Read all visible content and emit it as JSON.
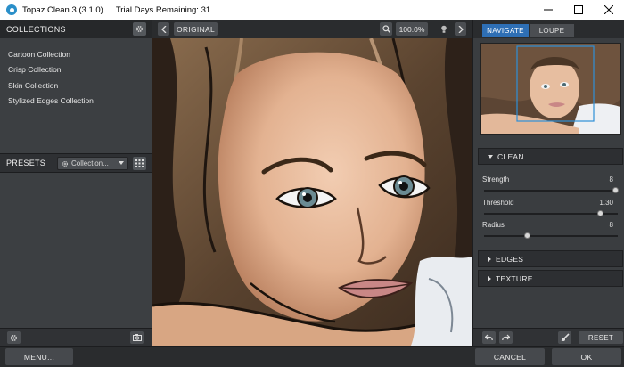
{
  "titlebar": {
    "app_title": "Topaz Clean 3 (3.1.0)",
    "trial_text": "Trial Days Remaining: 31"
  },
  "collections": {
    "header": "COLLECTIONS",
    "items": [
      {
        "label": "Cartoon Collection"
      },
      {
        "label": "Crisp Collection"
      },
      {
        "label": "Skin Collection"
      },
      {
        "label": "Stylized Edges Collection"
      }
    ]
  },
  "presets": {
    "header": "PRESETS",
    "select_value": "Collection..."
  },
  "toolbar": {
    "original_label": "ORIGINAL",
    "zoom_level": "100.0%"
  },
  "navigator": {
    "tab_navigate": "NAVIGATE",
    "tab_loupe": "LOUPE",
    "active_tab": "NAVIGATE"
  },
  "clean": {
    "header": "CLEAN",
    "sliders": [
      {
        "label": "Strength",
        "value": "8",
        "fraction": 0.98
      },
      {
        "label": "Threshold",
        "value": "1.30",
        "fraction": 0.87
      },
      {
        "label": "Radius",
        "value": "8",
        "fraction": 0.32
      }
    ]
  },
  "edges": {
    "header": "EDGES"
  },
  "texture": {
    "header": "TEXTURE"
  },
  "right_footer": {
    "reset_label": "RESET"
  },
  "bottom": {
    "menu_label": "MENU...",
    "cancel_label": "CANCEL",
    "ok_label": "OK"
  },
  "colors": {
    "accent": "#2e6fb5",
    "panel": "#3c3f42",
    "header": "#26282a"
  }
}
